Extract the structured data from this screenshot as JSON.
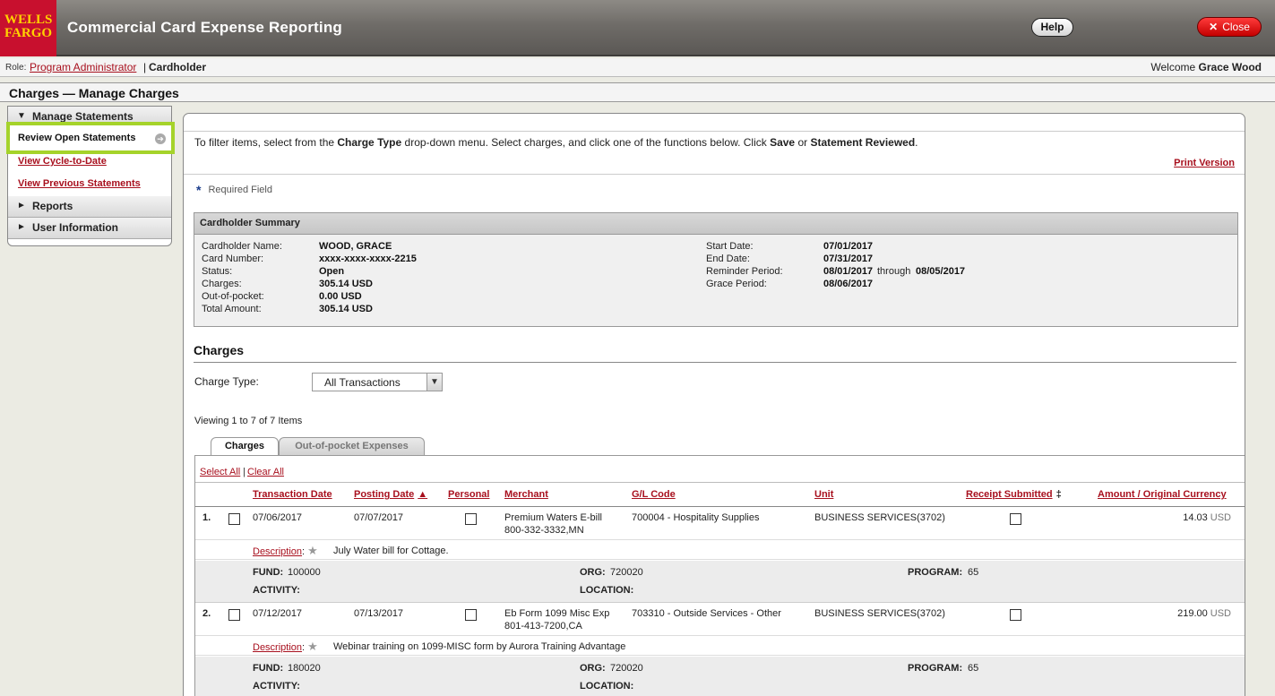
{
  "header": {
    "logo_line1": "WELLS",
    "logo_line2": "FARGO",
    "app_title": "Commercial Card Expense Reporting",
    "help_label": "Help",
    "close_label": "Close",
    "close_glyph": "✕"
  },
  "rolebar": {
    "role_label": "Role:",
    "role_link": "Program Administrator",
    "separator": "|",
    "current_role": "Cardholder",
    "welcome_prefix": "Welcome",
    "user_name": "Grace Wood"
  },
  "page_title": "Charges — Manage Charges",
  "nav": {
    "manage_statements": "Manage Statements",
    "review_open": "Review Open Statements",
    "cycle_to_date": "View Cycle-to-Date",
    "previous_statements": "View Previous Statements",
    "reports": "Reports",
    "user_information": "User Information",
    "expanded_glyph": "▼",
    "collapsed_glyph": "►",
    "arrow_glyph": "➔"
  },
  "main": {
    "instr_p1": "To filter items, select from the ",
    "instr_b1": "Charge Type",
    "instr_p2": " drop-down menu. Select charges, and click one of the functions below. Click ",
    "instr_b2": "Save",
    "instr_p3": " or ",
    "instr_b3": "Statement Reviewed",
    "instr_p4": ".",
    "print_version": "Print Version",
    "required_star": "*",
    "required_field": "Required Field"
  },
  "summary": {
    "heading": "Cardholder Summary",
    "left": [
      {
        "label": "Cardholder Name:",
        "value": "WOOD, GRACE"
      },
      {
        "label": "Card Number:",
        "value": "xxxx-xxxx-xxxx-2215"
      },
      {
        "label": "Status:",
        "value": "Open"
      },
      {
        "label": "Charges:",
        "value": "305.14 USD"
      },
      {
        "label": "Out-of-pocket:",
        "value": "0.00 USD"
      },
      {
        "label": "Total Amount:",
        "value": "305.14 USD"
      }
    ],
    "right": [
      {
        "label": "Start Date:",
        "value": "07/01/2017"
      },
      {
        "label": "End Date:",
        "value": "07/31/2017"
      },
      {
        "label": "Reminder Period:",
        "value": "08/01/2017"
      },
      {
        "label": "Grace Period:",
        "value": "08/06/2017"
      }
    ],
    "through_word": "through",
    "reminder_end": "08/05/2017"
  },
  "charges": {
    "heading": "Charges",
    "charge_type_label": "Charge Type:",
    "charge_type_value": "All Transactions",
    "dropdown_glyph": "▼",
    "viewing": "Viewing 1 to 7 of 7 Items",
    "tab_charges": "Charges",
    "tab_oop": "Out-of-pocket Expenses",
    "select_all": "Select All",
    "sel_sep": "|",
    "clear_all": "Clear All",
    "columns": {
      "transaction_date": "Transaction Date",
      "posting_date": "Posting Date",
      "personal": "Personal",
      "merchant": "Merchant",
      "gl_code": "G/L Code",
      "unit": "Unit",
      "receipt_submitted": "Receipt Submitted",
      "amount": "Amount / Original Currency"
    },
    "sort_glyph": "▲",
    "dagger_glyph": "‡",
    "description_label": "Description",
    "desc_colon": ":",
    "star_glyph": "★",
    "fund_label": "FUND:",
    "org_label": "ORG:",
    "program_label": "PROGRAM:",
    "activity_label": "ACTIVITY:",
    "location_label": "LOCATION:",
    "rows": [
      {
        "num": "1.",
        "transaction_date": "07/06/2017",
        "posting_date": "07/07/2017",
        "merchant_l1": "Premium Waters E-bill",
        "merchant_l2": "800-332-3332,MN",
        "gl_code": "700004 - Hospitality Supplies",
        "unit": "BUSINESS SERVICES(3702)",
        "amount": "14.03",
        "currency": "USD",
        "description": "July Water bill for Cottage.",
        "fund": "100000",
        "org": "720020",
        "program": "65",
        "activity": "",
        "location": ""
      },
      {
        "num": "2.",
        "transaction_date": "07/12/2017",
        "posting_date": "07/13/2017",
        "merchant_l1": "Eb Form 1099 Misc Exp",
        "merchant_l2": "801-413-7200,CA",
        "gl_code": "703310 - Outside Services - Other",
        "unit": "BUSINESS SERVICES(3702)",
        "amount": "219.00",
        "currency": "USD",
        "description": "Webinar training on 1099-MISC form by Aurora Training Advantage",
        "fund": "180020",
        "org": "720020",
        "program": "65",
        "activity": "",
        "location": ""
      }
    ]
  },
  "colors": {
    "brand_red": "#c8102e",
    "brand_gold": "#ffd200",
    "link_red": "#a8101e",
    "active_highlight": "#a5d32a"
  }
}
